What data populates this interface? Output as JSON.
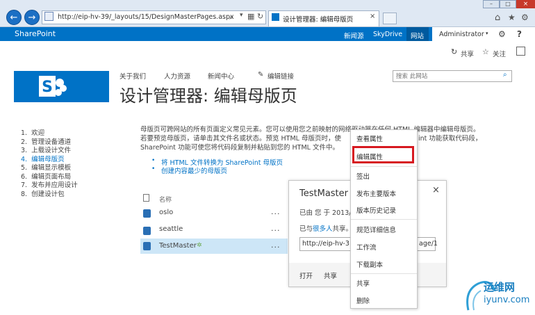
{
  "browser": {
    "url": "http://eip-hv-39/_layouts/15/DesignMasterPages.aspx",
    "tab_title": "设计管理器: 编辑母版页"
  },
  "suite": {
    "brand": "SharePoint",
    "links": [
      "新闻源",
      "SkyDrive",
      "网站"
    ],
    "user": "Administrator"
  },
  "ribbon": {
    "share": "共享",
    "follow": "关注"
  },
  "top_links": [
    "关于我们",
    "人力资源",
    "新闻中心"
  ],
  "edit_links": "编辑链接",
  "search_placeholder": "搜索 此网站",
  "page_title": "设计管理器: 编辑母版页",
  "left_nav": [
    {
      "num": "1.",
      "label": "欢迎"
    },
    {
      "num": "2.",
      "label": "管理设备通道"
    },
    {
      "num": "3.",
      "label": "上载设计文件"
    },
    {
      "num": "4.",
      "label": "编辑母版页"
    },
    {
      "num": "5.",
      "label": "编辑显示模板"
    },
    {
      "num": "6.",
      "label": "编辑页面布局"
    },
    {
      "num": "7.",
      "label": "发布并应用设计"
    },
    {
      "num": "8.",
      "label": "创建设计包"
    }
  ],
  "description": {
    "line1": "母版页可跨网站的所有页面定义常见元素。您可以使用您之前映射的网络驱动器在任何 HTML 编辑器中编辑母版页。",
    "line2": "若要预览母版页，请单击其文件名或状态。预览 HTML 母版页时，使",
    "line2b": "int 功能获取代码段，",
    "line3": "SharePoint 功能可使您将代码段复制并粘贴到您的 HTML 文件中。",
    "link1": "将 HTML 文件转换为 SharePoint 母版页",
    "link2": "创建内容最少的母版页"
  },
  "list": {
    "col_name": "名称",
    "rows": [
      "oslo",
      "seattle",
      "TestMaster"
    ],
    "more": "..."
  },
  "callout": {
    "title": "TestMaster",
    "line1": "已由 您 于 2013/",
    "shared_prefix": "已与",
    "shared_link": "很多人",
    "shared_suffix": "共享。",
    "url_start": "http://eip-hv-3",
    "url_end": "age/1",
    "open": "打开",
    "share": "共享",
    "close": "×"
  },
  "menu": {
    "items": [
      "查看属性",
      "编辑属性",
      "签出",
      "发布主要版本",
      "版本历史记录",
      "规范详细信息",
      "工作流",
      "下载副本",
      "共享",
      "删除"
    ]
  },
  "watermark": {
    "cn": "运维网",
    "domain": "iyunv.com"
  },
  "colors": {
    "suite_blue": "#0072c6",
    "highlight_red": "#d71920"
  }
}
